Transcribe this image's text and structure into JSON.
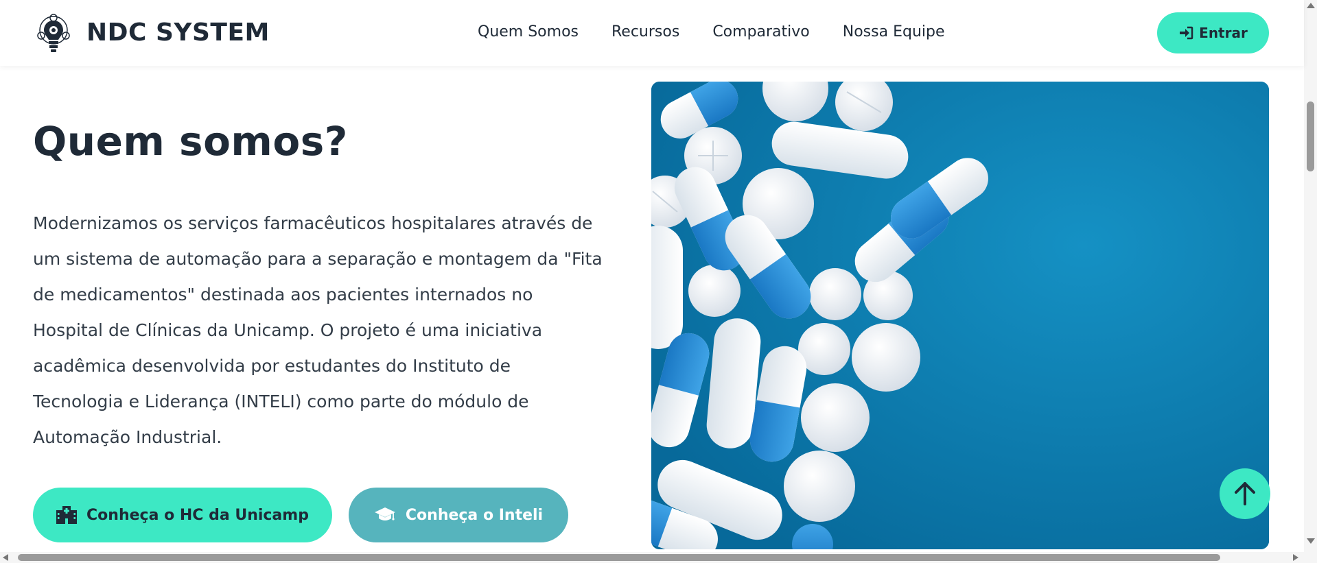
{
  "header": {
    "brand_name": "NDC SYSTEM",
    "nav": [
      "Quem Somos",
      "Recursos",
      "Comparativo",
      "Nossa Equipe"
    ],
    "login_label": "Entrar"
  },
  "hero": {
    "title": "Quem somos?",
    "paragraph": "Modernizamos os serviços farmacêuticos hospitalares através de um sistema de automação para a separação e montagem da \"Fita de medicamentos\" destinada aos pacientes internados no Hospital de Clínicas da Unicamp. O projeto é uma iniciativa acadêmica desenvolvida por estudantes do Instituto de Tecnologia e Liderança (INTELI) como parte do módulo de Automação Industrial.",
    "buttons": {
      "hc_label": "Conheça o HC da Unicamp",
      "inteli_label": "Conheça o Inteli"
    }
  },
  "icons": {
    "brand_logo": "lightbulb-gear-icon",
    "login": "sign-in-icon",
    "hc": "hospital-icon",
    "inteli": "graduation-cap-icon",
    "top": "arrow-up-icon"
  },
  "colors": {
    "accent": "#3de8c4",
    "secondary": "#56b4bd",
    "text": "#1f2a37",
    "image_bg": "#0a7fb0"
  }
}
